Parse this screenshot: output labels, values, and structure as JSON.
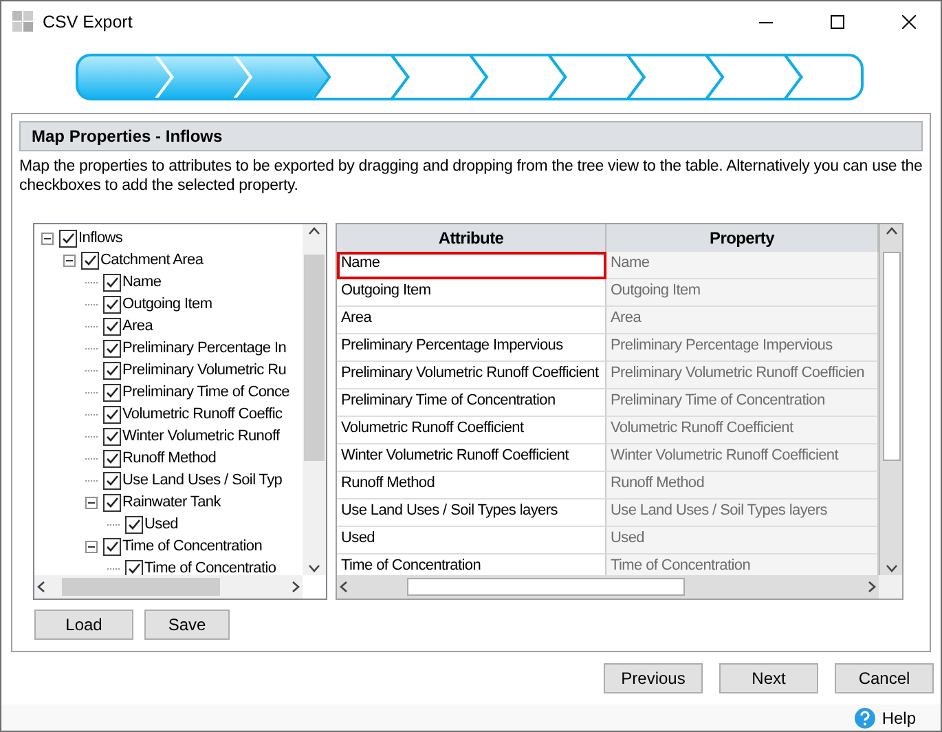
{
  "window": {
    "title": "CSV Export"
  },
  "progress": {
    "steps": [
      {
        "completed": true
      },
      {
        "completed": true
      },
      {
        "completed": true
      },
      {
        "completed": false
      },
      {
        "completed": false
      },
      {
        "completed": false
      },
      {
        "completed": false
      },
      {
        "completed": false
      },
      {
        "completed": false
      },
      {
        "completed": false
      }
    ]
  },
  "panel": {
    "title": "Map Properties - Inflows",
    "description": "Map the properties to attributes to be exported by dragging and dropping from the tree view to the table. Alternatively you can use the checkboxes to add the selected property."
  },
  "tree": [
    {
      "label": "Inflows",
      "checked": true,
      "expanded": true,
      "children": [
        {
          "label": "Catchment Area",
          "checked": true,
          "expanded": true,
          "children": [
            {
              "label": "Name",
              "checked": true
            },
            {
              "label": "Outgoing Item",
              "checked": true
            },
            {
              "label": "Area",
              "checked": true
            },
            {
              "label": "Preliminary Percentage In",
              "checked": true
            },
            {
              "label": "Preliminary Volumetric Ru",
              "checked": true
            },
            {
              "label": "Preliminary Time of Conce",
              "checked": true
            },
            {
              "label": "Volumetric Runoff Coeffic",
              "checked": true
            },
            {
              "label": "Winter Volumetric Runoff",
              "checked": true
            },
            {
              "label": "Runoff Method",
              "checked": true
            },
            {
              "label": "Use Land Uses / Soil Typ",
              "checked": true
            },
            {
              "label": "Rainwater Tank",
              "checked": true,
              "expanded": true,
              "children": [
                {
                  "label": "Used",
                  "checked": true
                }
              ]
            },
            {
              "label": "Time of Concentration",
              "checked": true,
              "expanded": true,
              "children": [
                {
                  "label": "Time of Concentratio",
                  "checked": true
                }
              ]
            }
          ]
        }
      ]
    }
  ],
  "table": {
    "columns": [
      "Attribute",
      "Property"
    ],
    "rows": [
      {
        "attribute": "Name",
        "property": "Name",
        "selected": true
      },
      {
        "attribute": "Outgoing Item",
        "property": "Outgoing Item",
        "selected": false
      },
      {
        "attribute": "Area",
        "property": "Area",
        "selected": false
      },
      {
        "attribute": "Preliminary Percentage Impervious",
        "property": "Preliminary Percentage Impervious",
        "selected": false
      },
      {
        "attribute": "Preliminary Volumetric Runoff Coefficient",
        "property": "Preliminary Volumetric Runoff Coefficien",
        "selected": false
      },
      {
        "attribute": "Preliminary Time of Concentration",
        "property": "Preliminary Time of Concentration",
        "selected": false
      },
      {
        "attribute": "Volumetric Runoff Coefficient",
        "property": "Volumetric Runoff Coefficient",
        "selected": false
      },
      {
        "attribute": "Winter Volumetric Runoff Coefficient",
        "property": "Winter Volumetric Runoff Coefficient",
        "selected": false
      },
      {
        "attribute": "Runoff Method",
        "property": "Runoff Method",
        "selected": false
      },
      {
        "attribute": "Use Land Uses / Soil Types layers",
        "property": "Use Land Uses / Soil Types layers",
        "selected": false
      },
      {
        "attribute": "Used",
        "property": "Used",
        "selected": false
      },
      {
        "attribute": "Time of Concentration",
        "property": "Time of Concentration",
        "selected": false
      }
    ]
  },
  "panel_buttons": [
    "Load",
    "Save"
  ],
  "wizard_buttons": [
    "Previous",
    "Next",
    "Cancel"
  ],
  "help": "Help"
}
